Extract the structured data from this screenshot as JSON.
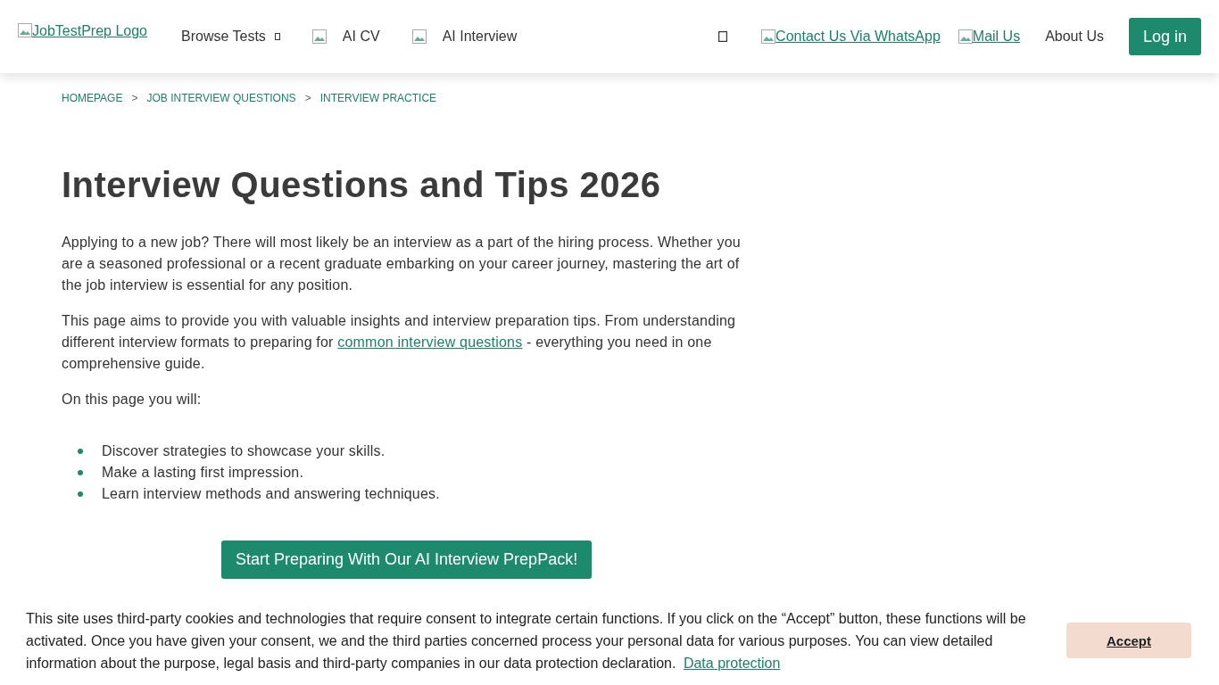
{
  "header": {
    "logo_alt": "JobTestPrep Logo",
    "nav": [
      {
        "label": "Browse Tests",
        "kind": "dropdown"
      },
      {
        "label": "AI CV",
        "kind": "image"
      },
      {
        "label": "AI Interview",
        "kind": "image"
      }
    ],
    "links": [
      {
        "label": "Contact Us Via WhatsApp",
        "kind": "image-link"
      },
      {
        "label": "Mail Us",
        "kind": "image-link"
      },
      {
        "label": "About Us",
        "kind": "plain"
      }
    ],
    "login": "Log in"
  },
  "breadcrumb": [
    "HOMEPAGE",
    "JOB INTERVIEW QUESTIONS",
    "INTERVIEW PRACTICE"
  ],
  "breadcrumb_separator": ">",
  "title": "Interview Questions and Tips 2026",
  "intro": "Applying to a new job? There will most likely be an interview as a part of the hiring process. Whether you are a seasoned professional or a recent graduate embarking on your career journey, mastering the art of the job interview is essential for any position.",
  "paragraph": {
    "before": "This page aims to provide you with valuable insights and interview preparation tips. From understanding different interview formats to preparing for ",
    "link": "common interview questions",
    "after": " - everything you need in one comprehensive guide."
  },
  "list_intro": "On this page you will:",
  "bullets": [
    "Discover strategies to showcase your skills.",
    "Make a lasting first impression.",
    "Learn interview methods and answering techniques."
  ],
  "cta": "Start Preparing With Our AI Interview PrepPack!",
  "cookie": {
    "text": "This site uses third-party cookies and technologies that require consent to integrate certain functions. If you click on the “Accept” button, these functions will be activated. Once you have given your consent, we and the third parties concerned process your personal data for various purposes. You can view detailed information about the purpose, legal basis and third-party companies in our data protection declaration.",
    "link": "Data protection",
    "accept": "Accept"
  }
}
